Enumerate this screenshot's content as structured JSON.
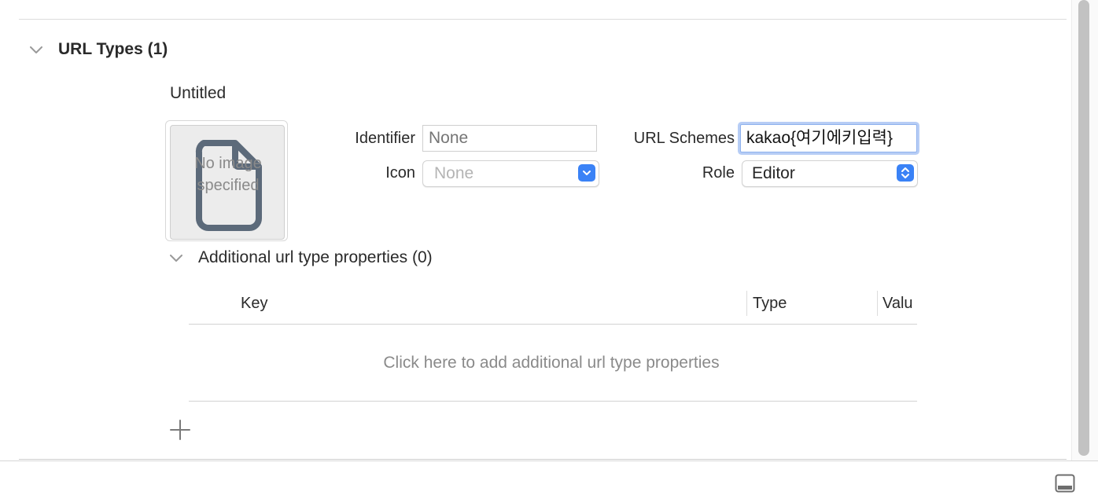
{
  "section": {
    "title": "URL Types (1)",
    "entry": {
      "name": "Untitled",
      "image_well": {
        "placeholder_text": "No image specified"
      },
      "identifier": {
        "label": "Identifier",
        "value": "",
        "placeholder": "None"
      },
      "icon": {
        "label": "Icon",
        "value": "None"
      },
      "url_schemes": {
        "label": "URL Schemes",
        "value": "kakao{여기에키입력}"
      },
      "role": {
        "label": "Role",
        "value": "Editor"
      }
    },
    "additional": {
      "title": "Additional url type properties (0)",
      "columns": [
        "Key",
        "Type",
        "Valu"
      ],
      "empty_hint": "Click here to add additional url type properties"
    }
  },
  "icons": [
    "chevron-down-icon",
    "document-icon",
    "plus-icon",
    "popup-chevron-icon",
    "updown-arrows-icon",
    "panel-toggle-icon"
  ],
  "colors": {
    "accent": "#3a82f6",
    "focus_ring": "#b7cdf5",
    "divider": "#dcdcdc"
  }
}
